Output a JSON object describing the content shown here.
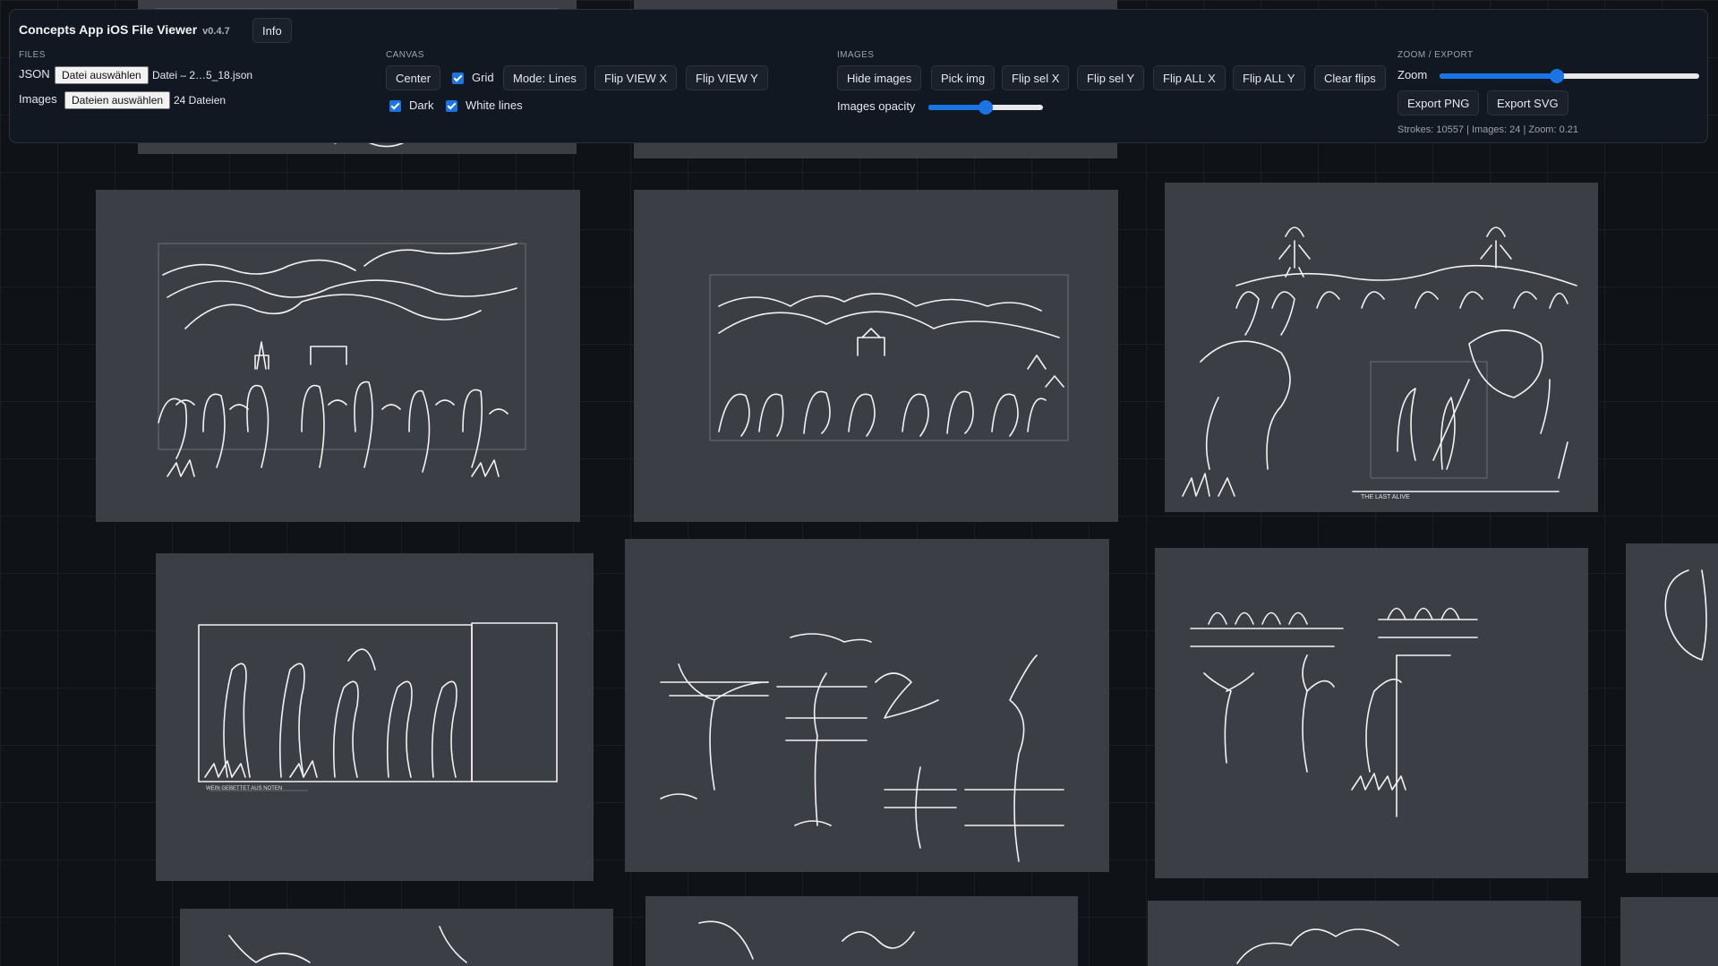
{
  "app": {
    "title": "Concepts App iOS File Viewer",
    "version": "v0.4.7",
    "info_label": "Info"
  },
  "files": {
    "section": "FILES",
    "json_label": "JSON",
    "json_button": "Datei auswählen",
    "json_file": "Datei – 2…5_18.json",
    "images_label": "Images",
    "images_button": "Dateien auswählen",
    "images_count": "24 Dateien"
  },
  "canvas": {
    "section": "CANVAS",
    "center": "Center",
    "grid": "Grid",
    "grid_checked": true,
    "mode": "Mode: Lines",
    "flip_view_x": "Flip VIEW X",
    "flip_view_y": "Flip VIEW Y",
    "dark": "Dark",
    "dark_checked": true,
    "white_lines": "White lines",
    "white_lines_checked": true
  },
  "images": {
    "section": "IMAGES",
    "hide": "Hide images",
    "pick": "Pick img",
    "flip_sel_x": "Flip sel X",
    "flip_sel_y": "Flip sel Y",
    "flip_all_x": "Flip ALL X",
    "flip_all_y": "Flip ALL Y",
    "clear_flips": "Clear flips",
    "opacity_label": "Images opacity",
    "opacity_value": 0.5
  },
  "zoom_export": {
    "section": "ZOOM / EXPORT",
    "zoom_label": "Zoom",
    "zoom_value": 0.45,
    "export_png": "Export PNG",
    "export_svg": "Export SVG",
    "stats": "Strokes: 10557 | Images: 24 | Zoom: 0.21"
  },
  "drawings": {
    "tile3_caption": "THE LAST ALIVE",
    "tile4_caption": "WEIN GEBETTET AUS NOTEN"
  },
  "colors": {
    "accent": "#1b74e4",
    "panel": "#121821",
    "tile": "#3b3f45",
    "canvas": "#0f1217"
  }
}
